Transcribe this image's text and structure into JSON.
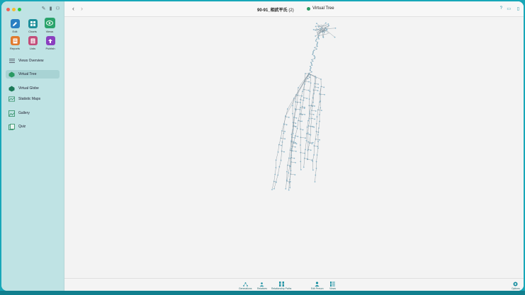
{
  "window": {
    "title": "90-91_相武平氏",
    "title_count": "(2)",
    "view_name": "Virtual Tree"
  },
  "sidebar": {
    "apps": [
      {
        "label": "Edit",
        "color": "#2a7fc2",
        "icon": "pencil-icon"
      },
      {
        "label": "Charts",
        "color": "#1e8f9a",
        "icon": "charts-icon"
      },
      {
        "label": "Views",
        "color": "#2aa36b",
        "icon": "eye-icon"
      },
      {
        "label": "Reports",
        "color": "#e07a2d",
        "icon": "reports-icon"
      },
      {
        "label": "Lists",
        "color": "#c24d7a",
        "icon": "lists-icon"
      },
      {
        "label": "Publish",
        "color": "#8a3fbf",
        "icon": "publish-icon"
      }
    ],
    "nav": [
      {
        "label": "Views Overview",
        "icon": "list-icon"
      },
      {
        "label": "Virtual Tree",
        "icon": "tree-icon"
      },
      {
        "label": "Virtual Globe",
        "icon": "globe-icon"
      },
      {
        "label": "Statistic Maps",
        "icon": "map-icon"
      },
      {
        "label": "Gallery",
        "icon": "gallery-icon"
      },
      {
        "label": "Quiz",
        "icon": "quiz-icon"
      }
    ]
  },
  "bottombar": {
    "items": [
      {
        "label": "Generations",
        "icon": "generations-icon"
      },
      {
        "label": "Relatives",
        "icon": "relatives-icon"
      },
      {
        "label": "Relationship Paths",
        "icon": "relationship-paths-icon"
      },
      {
        "label": "Edit Person",
        "icon": "edit-person-icon"
      },
      {
        "label": "Views",
        "icon": "views-icon"
      }
    ],
    "options_label": "Options"
  },
  "colors": {
    "accent": "#1a8fa0",
    "sidebar_bg": "#bfe3e4",
    "tree_node": "#8db8cc",
    "tree_line": "#7f8f99"
  }
}
